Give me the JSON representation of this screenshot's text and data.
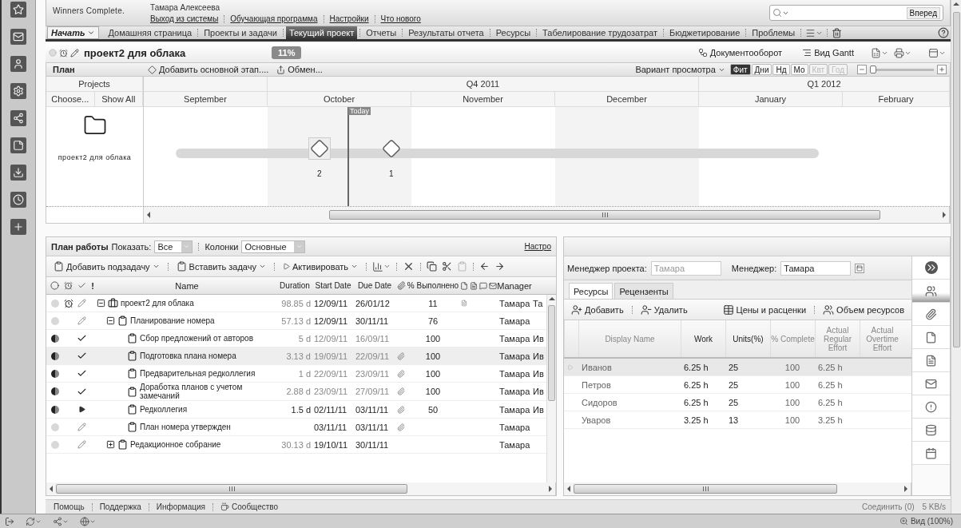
{
  "header": {
    "tagline": "Winners Complete.",
    "user": "Тамара Алексеева",
    "links": [
      "Выход из системы",
      "Обучающая программа",
      "Настройки",
      "Что нового"
    ],
    "search_button": "Вперед"
  },
  "nav": {
    "start": "Начать",
    "tabs": [
      {
        "label": "Домашняя страница",
        "selected": false
      },
      {
        "label": "Проекты и задачи",
        "selected": false
      },
      {
        "label": "Текущий проект",
        "selected": true
      },
      {
        "label": "Отчеты",
        "selected": false
      },
      {
        "label": "Результаты отчета",
        "selected": false
      },
      {
        "label": "Ресурсы",
        "selected": false
      },
      {
        "label": "Табелирование трудозатрат",
        "selected": false
      },
      {
        "label": "Бюджетирование",
        "selected": false
      },
      {
        "label": "Проблемы",
        "selected": false
      }
    ]
  },
  "project": {
    "title": "проект2 для облака",
    "progress": "11%",
    "actions": [
      "Документооборот",
      "Вид Gantt"
    ]
  },
  "plan_bar": {
    "title": "План",
    "actions": [
      "Добавить основной этап....",
      "Обмен..."
    ],
    "view": "Вариант просмотра",
    "scales": [
      {
        "label": "Фит",
        "selected": true,
        "disabled": false
      },
      {
        "label": "Дни",
        "selected": false,
        "disabled": false
      },
      {
        "label": "Нд",
        "selected": false,
        "disabled": false
      },
      {
        "label": "Мо",
        "selected": false,
        "disabled": false
      },
      {
        "label": "Квт",
        "selected": false,
        "disabled": true
      },
      {
        "label": "Год",
        "selected": false,
        "disabled": true
      }
    ],
    "zoom": {
      "level": 0.05
    }
  },
  "gantt": {
    "projects_header": "Projects",
    "choose": "Choose...",
    "show_all": "Show All",
    "project_name": "проект2 для облака",
    "today": "Today",
    "quarters": [
      {
        "months": [
          "September"
        ]
      },
      {
        "label": "Q4 2011",
        "months": [
          "October",
          "November",
          "December"
        ]
      },
      {
        "label": "Q1 2012",
        "months": [
          "January",
          "February"
        ]
      }
    ],
    "milestones": [
      {
        "label": "2",
        "selected": true
      },
      {
        "label": "1",
        "selected": false
      }
    ]
  },
  "work_plan": {
    "title": "План работы",
    "show_label": "Показать:",
    "show_value": "Все",
    "columns_label": "Колонки",
    "columns_value": "Основные",
    "settings_link": "Настро",
    "actions": [
      "Добавить подзадачу",
      "Вставить задачу",
      "Активировать"
    ],
    "flag_header": "!",
    "columns": [
      "Name",
      "Duration",
      "Start Date",
      "Due Date",
      "% Выполнено",
      "Manager"
    ],
    "rows": [
      {
        "kind": "project",
        "expanded": true,
        "name": "проект2 для облака",
        "duration": "98.85 d",
        "start": "12/09/11",
        "due": "26/01/12",
        "attachment": false,
        "percent": "11",
        "note": true,
        "manager": "Тамара",
        "extra": "Та",
        "started": false,
        "completed": false,
        "in_progress": false,
        "alarm": true,
        "selected": false,
        "children": [
          {
            "kind": "group",
            "expanded": true,
            "name": "Планирование номера",
            "duration": "57.13 d",
            "start": "12/09/11",
            "due": "30/11/11",
            "attachment": false,
            "percent": "76",
            "note": false,
            "manager": "Тамара",
            "started": false,
            "completed": false,
            "in_progress": false,
            "alarm": false,
            "selected": false,
            "children": [
              {
                "kind": "task",
                "name": "Сбор предложений от авторов",
                "duration": "5 d",
                "start": "12/09/11",
                "due": "16/09/11",
                "attachment": false,
                "percent": "100",
                "note": false,
                "manager": "Тамара",
                "extra": "Ив",
                "started": true,
                "completed": true,
                "in_progress": false,
                "alarm": false,
                "selected": false
              },
              {
                "kind": "task",
                "name": "Подготовка плана номера",
                "duration": "3.13 d",
                "start": "19/09/11",
                "due": "22/09/11",
                "attachment": true,
                "percent": "100",
                "note": false,
                "manager": "Тамара",
                "extra": "Ив",
                "started": true,
                "completed": true,
                "in_progress": false,
                "alarm": false,
                "selected": true
              },
              {
                "kind": "task",
                "name": "Предварительная редколлегия",
                "duration": "1 d",
                "start": "22/09/11",
                "due": "23/09/11",
                "attachment": true,
                "percent": "100",
                "note": false,
                "manager": "Тамара",
                "extra": "Ив",
                "started": true,
                "completed": true,
                "in_progress": false,
                "alarm": false,
                "selected": false
              },
              {
                "kind": "task",
                "name": "Доработка планов с учетом замечаний",
                "duration": "2.88 d",
                "start": "23/09/11",
                "due": "27/09/11",
                "attachment": true,
                "percent": "100",
                "note": false,
                "manager": "Тамара",
                "extra": "Ив",
                "started": true,
                "completed": true,
                "in_progress": false,
                "alarm": false,
                "selected": false
              },
              {
                "kind": "task",
                "name": "Редколлегия",
                "duration": "1.5 d",
                "start": "02/11/11",
                "due": "03/11/11",
                "attachment": true,
                "percent": "50",
                "note": false,
                "manager": "Тамара",
                "extra": "Ив",
                "started": true,
                "completed": false,
                "in_progress": true,
                "alarm": false,
                "selected": false
              },
              {
                "kind": "task",
                "name": "План номера утвержден",
                "start": "03/11/11",
                "due": "03/11/11",
                "attachment": true,
                "note": false,
                "manager": "Тамара",
                "started": false,
                "completed": false,
                "in_progress": false,
                "alarm": false,
                "selected": false
              }
            ]
          },
          {
            "kind": "group",
            "expanded": false,
            "name": "Редакционное собрание",
            "duration": "30.13 d",
            "start": "19/10/11",
            "due": "30/11/11",
            "attachment": false,
            "note": false,
            "manager": "Тамара",
            "started": false,
            "completed": false,
            "in_progress": false,
            "alarm": false,
            "selected": false
          }
        ]
      }
    ]
  },
  "resources": {
    "fields": [
      {
        "label": "Менеджер проекта:",
        "value": "Тамара",
        "disabled": true
      },
      {
        "label": "Менеджер:",
        "value": "Тамара",
        "disabled": false
      }
    ],
    "tabs": [
      {
        "label": "Ресурсы",
        "selected": true
      },
      {
        "label": "Рецензенты",
        "selected": false
      }
    ],
    "actions": [
      "Добавить",
      "Удалить",
      "Цены и расценки",
      "Объем ресурсов"
    ],
    "columns": [
      "Display Name",
      "Work",
      "Units(%)",
      "% Complete",
      "Actual Regular Effort",
      "Actual Overtime Effort"
    ],
    "rows": [
      {
        "name": "Иванов",
        "work": "6.25 h",
        "units": "25",
        "complete": "100",
        "regular": "6.25 h",
        "selected": true
      },
      {
        "name": "Петров",
        "work": "6.25 h",
        "units": "25",
        "complete": "100",
        "regular": "6.25 h",
        "selected": false
      },
      {
        "name": "Сидоров",
        "work": "6.25 h",
        "units": "25",
        "complete": "100",
        "regular": "6.25 h",
        "selected": false
      },
      {
        "name": "Уваров",
        "work": "3.25 h",
        "units": "13",
        "complete": "100",
        "regular": "3.25 h",
        "selected": false
      }
    ],
    "side_tabs": [
      {
        "selected": true
      },
      {
        "selected": false
      },
      {
        "selected": false
      },
      {
        "selected": false
      },
      {
        "selected": false
      },
      {
        "selected": false
      },
      {
        "selected": false
      },
      {
        "selected": false
      }
    ]
  },
  "footer": {
    "links": [
      "Помощь",
      "Поддержка",
      "Информация",
      "Сообщество"
    ],
    "connect": "Соединить (0)",
    "speed": "5 KB/s",
    "zoom": "Вид (100%)"
  }
}
